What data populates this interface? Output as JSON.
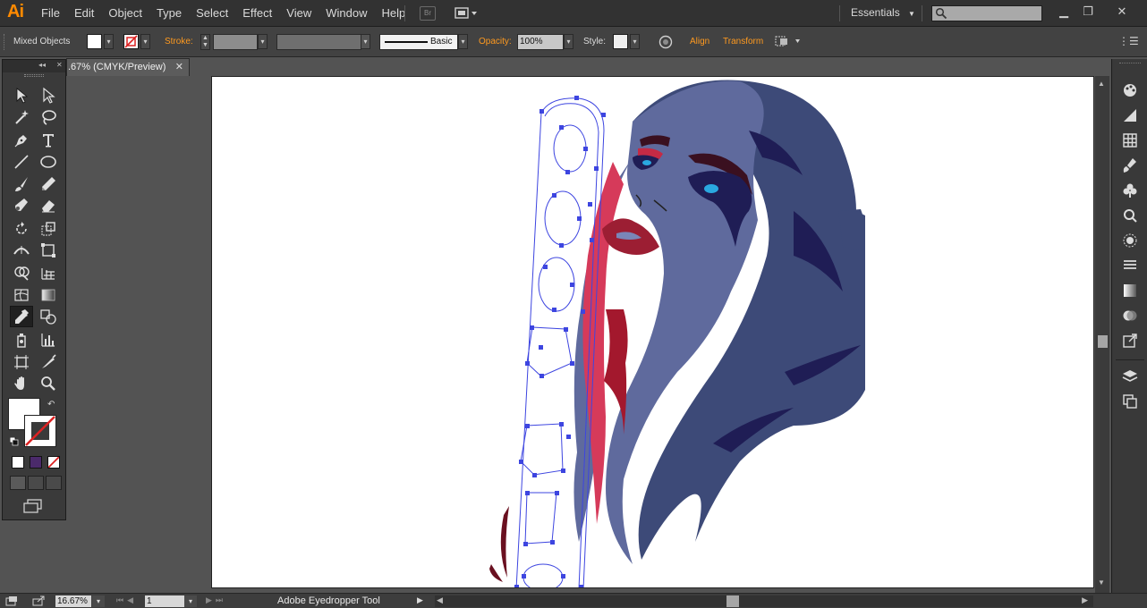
{
  "app": {
    "logo": "Ai"
  },
  "menu": [
    {
      "label": "File"
    },
    {
      "label": "Edit"
    },
    {
      "label": "Object"
    },
    {
      "label": "Type"
    },
    {
      "label": "Select"
    },
    {
      "label": "Effect"
    },
    {
      "label": "View"
    },
    {
      "label": "Window"
    },
    {
      "label": "Help"
    }
  ],
  "bridge_label": "Br",
  "workspace": {
    "label": "Essentials",
    "icon": "chevron-down-icon"
  },
  "search": {
    "placeholder": "",
    "icon": "search-icon"
  },
  "window_controls": {
    "minimize": "▁",
    "restore": "❐",
    "close": "✕"
  },
  "control_bar": {
    "selection": "Mixed Objects",
    "stroke_label": "Stroke:",
    "brush": "Basic",
    "opacity_label": "Opacity:",
    "opacity_value": "100%",
    "style_label": "Style:",
    "align_label": "Align",
    "transform_label": "Transform",
    "colors": {
      "accent": "#ff9a1f",
      "fill": "#ffffff"
    }
  },
  "tools_panel": {
    "collapse": "◂◂",
    "close": "✕"
  },
  "document": {
    "tab_title": ".67% (CMYK/Preview)",
    "close": "✕"
  },
  "status_bar": {
    "zoom": "16.67%",
    "page": "1",
    "active_tool": "Adobe Eyedropper Tool"
  },
  "artwork": {
    "colors": {
      "hair_dark": "#3d4a78",
      "hair_light": "#5f6a9d",
      "hair_shadow": "#1f1d55",
      "lips": "#9c1e33",
      "pink": "#d63a5a",
      "dark_red": "#a3182d",
      "path_selection": "#3d45e0",
      "eye_blue": "#2aa8e0"
    }
  }
}
